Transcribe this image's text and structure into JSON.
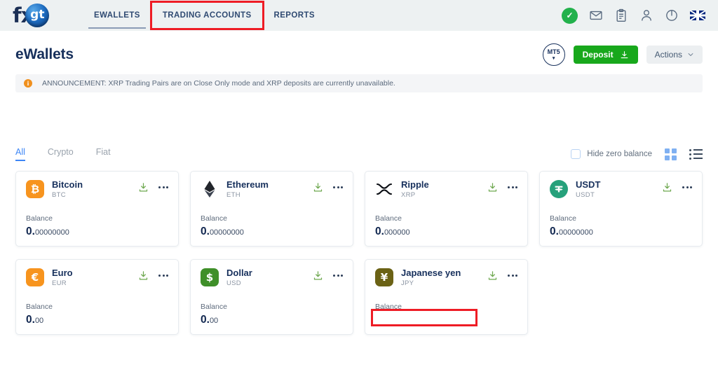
{
  "header": {
    "logo_fx": "fx",
    "logo_gt": "gt",
    "nav": [
      {
        "label": "EWALLETS",
        "active": true
      },
      {
        "label": "TRADING ACCOUNTS",
        "active": false,
        "highlighted": true
      },
      {
        "label": "REPORTS",
        "active": false
      }
    ],
    "icons": [
      "check-circle-icon",
      "envelope-icon",
      "clipboard-icon",
      "person-icon",
      "power-icon",
      "uk-flag-icon"
    ],
    "accent_green": "#22b14c",
    "background": "#edf1f2"
  },
  "page": {
    "title": "eWallets",
    "mt5_label": "MT5",
    "deposit_label": "Deposit",
    "actions_label": "Actions",
    "deposit_color": "#18a81c"
  },
  "announcement": {
    "text": "ANNOUNCEMENT: XRP Trading Pairs are on Close Only mode and XRP deposits are currently unavailable.",
    "icon": "info-icon",
    "icon_color": "#f0901e"
  },
  "filters": {
    "tabs": [
      {
        "label": "All",
        "active": true
      },
      {
        "label": "Crypto",
        "active": false
      },
      {
        "label": "Fiat",
        "active": false
      }
    ],
    "hide_zero_balance_label": "Hide zero balance",
    "hide_zero_balance_checked": false,
    "view_grid_icon": "grid-view-icon",
    "view_list_icon": "list-view-icon",
    "active_tab_color": "#3d86f5"
  },
  "wallets": [
    {
      "name": "Bitcoin",
      "symbol": "BTC",
      "glyph": "Ƀ",
      "icon_bg": "#f7941e",
      "icon_shape": "square",
      "balance_label": "Balance",
      "balance_int": "0.",
      "balance_dec": "00000000",
      "redacted": false
    },
    {
      "name": "Ethereum",
      "symbol": "ETH",
      "glyph": "eth-diamond",
      "icon_bg": "none",
      "icon_shape": "bare",
      "balance_label": "Balance",
      "balance_int": "0.",
      "balance_dec": "00000000",
      "redacted": false
    },
    {
      "name": "Ripple",
      "symbol": "XRP",
      "glyph": "xrp-x",
      "icon_bg": "none",
      "icon_shape": "bare",
      "balance_label": "Balance",
      "balance_int": "0.",
      "balance_dec": "000000",
      "redacted": false
    },
    {
      "name": "USDT",
      "symbol": "USDT",
      "glyph": "₮",
      "icon_bg": "#26a17b",
      "icon_shape": "round",
      "balance_label": "Balance",
      "balance_int": "0.",
      "balance_dec": "00000000",
      "redacted": false
    },
    {
      "name": "Euro",
      "symbol": "EUR",
      "glyph": "€",
      "icon_bg": "#f7941e",
      "icon_shape": "square",
      "balance_label": "Balance",
      "balance_int": "0.",
      "balance_dec": "00",
      "redacted": false
    },
    {
      "name": "Dollar",
      "symbol": "USD",
      "glyph": "$",
      "icon_bg": "#3f8f29",
      "icon_shape": "square",
      "balance_label": "Balance",
      "balance_int": "0.",
      "balance_dec": "00",
      "redacted": false
    },
    {
      "name": "Japanese yen",
      "symbol": "JPY",
      "glyph": "¥",
      "icon_bg": "#6b6215",
      "icon_shape": "square",
      "balance_label": "Balance",
      "balance_int": "",
      "balance_dec": "",
      "redacted": true
    }
  ],
  "annotations": {
    "highlight_color": "#ee1c25",
    "boxes": [
      "trading-accounts-nav-tab",
      "japanese-yen-balance-value"
    ]
  }
}
